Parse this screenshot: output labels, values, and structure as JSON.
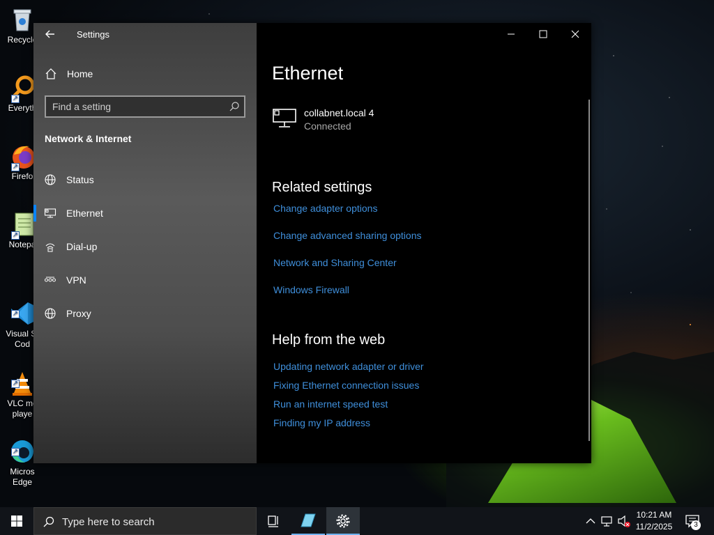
{
  "desktop": {
    "icons": [
      {
        "label": "Recycle",
        "icon": "recycle-bin-icon"
      },
      {
        "label": "Everyth",
        "icon": "everything-search-icon"
      },
      {
        "label": "Firefo",
        "icon": "firefox-icon"
      },
      {
        "label": "Notepa",
        "icon": "notepad-icon"
      },
      {
        "label": "Visual St\nCod",
        "icon": "vscode-icon"
      },
      {
        "label": "VLC me\nplaye",
        "icon": "vlc-icon"
      },
      {
        "label": "Micros\nEdge",
        "icon": "edge-icon"
      }
    ]
  },
  "window": {
    "title": "Settings",
    "sidebar": {
      "home_label": "Home",
      "search_placeholder": "Find a setting",
      "section_title": "Network & Internet",
      "items": [
        {
          "label": "Status",
          "icon": "globe-icon",
          "selected": false
        },
        {
          "label": "Ethernet",
          "icon": "ethernet-icon",
          "selected": true
        },
        {
          "label": "Dial-up",
          "icon": "dialup-icon",
          "selected": false
        },
        {
          "label": "VPN",
          "icon": "vpn-icon",
          "selected": false
        },
        {
          "label": "Proxy",
          "icon": "globe-icon",
          "selected": false
        }
      ]
    },
    "content": {
      "page_title": "Ethernet",
      "connection": {
        "name": "collabnet.local 4",
        "status": "Connected"
      },
      "related_title": "Related settings",
      "related_links": [
        "Change adapter options",
        "Change advanced sharing options",
        "Network and Sharing Center",
        "Windows Firewall"
      ],
      "help_title": "Help from the web",
      "help_links": [
        "Updating network adapter or driver",
        "Fixing Ethernet connection issues",
        "Run an internet speed test",
        "Finding my IP address"
      ]
    }
  },
  "taskbar": {
    "search_label": "Type here to search",
    "time": "10:21 AM",
    "date": "11/2/2025",
    "notification_count": "3"
  },
  "colors": {
    "accent": "#0a84ff",
    "link": "#3f8fdb"
  }
}
